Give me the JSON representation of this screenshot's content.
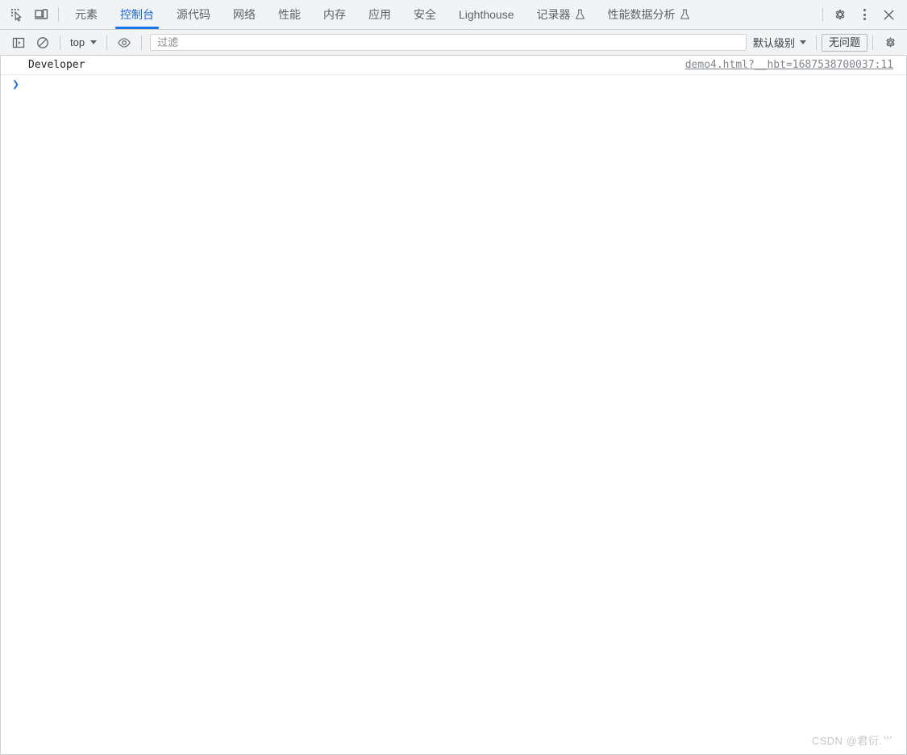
{
  "devtools": {
    "tabbar": {
      "inspect_icon": "inspect-element-icon",
      "device_icon": "device-toolbar-icon",
      "tabs": [
        {
          "label": "元素",
          "active": false,
          "beaker": false
        },
        {
          "label": "控制台",
          "active": true,
          "beaker": false
        },
        {
          "label": "源代码",
          "active": false,
          "beaker": false
        },
        {
          "label": "网络",
          "active": false,
          "beaker": false
        },
        {
          "label": "性能",
          "active": false,
          "beaker": false
        },
        {
          "label": "内存",
          "active": false,
          "beaker": false
        },
        {
          "label": "应用",
          "active": false,
          "beaker": false
        },
        {
          "label": "安全",
          "active": false,
          "beaker": false
        },
        {
          "label": "Lighthouse",
          "active": false,
          "beaker": false
        },
        {
          "label": "记录器",
          "active": false,
          "beaker": true
        },
        {
          "label": "性能数据分析",
          "active": false,
          "beaker": true
        }
      ],
      "settings_icon": "gear-icon",
      "more_icon": "more-vertical-icon",
      "close_icon": "close-icon"
    },
    "console_toolbar": {
      "sidebar_icon": "console-sidebar-icon",
      "clear_icon": "clear-console-icon",
      "context": "top",
      "eye_icon": "live-expression-eye-icon",
      "filter_placeholder": "过滤",
      "filter_value": "",
      "levels_label": "默认级别",
      "issues_label": "无问题",
      "settings_icon": "console-settings-gear-icon"
    },
    "console": {
      "messages": [
        {
          "text": "Developer",
          "source": "demo4.html?__hbt=1687538700037:11"
        }
      ],
      "prompt_chevron": "❯",
      "prompt_value": ""
    },
    "watermark": "CSDN @君衍.⺌",
    "colors": {
      "accent": "#1a73e8",
      "toolbar_bg": "#f1f3f4",
      "border": "#cdd0d3",
      "text": "#5f6368"
    }
  }
}
